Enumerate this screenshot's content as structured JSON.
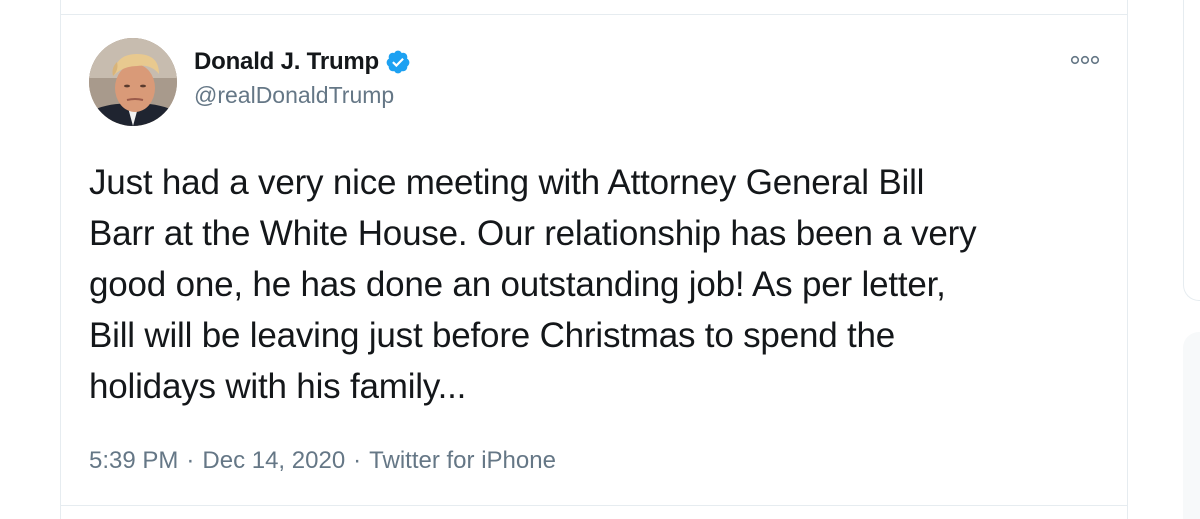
{
  "tweet": {
    "display_name": "Donald J. Trump",
    "handle": "@realDonaldTrump",
    "verified": true,
    "text_lines": [
      "Just had a very nice meeting with Attorney General Bill",
      "Barr at the White House. Our relationship has been a very",
      "good one, he has done an outstanding job! As per letter,",
      "Bill will be leaving just before Christmas to spend the",
      "holidays with his family..."
    ],
    "time": "5:39 PM",
    "separator": "·",
    "date": "Dec 14, 2020",
    "source": "Twitter for iPhone"
  },
  "icons": {
    "verified": "verified-badge-icon",
    "more": "more-options-icon"
  },
  "colors": {
    "accent": "#1da1f2",
    "text_primary": "#14171a",
    "text_secondary": "#657786",
    "border": "#e6ecf0"
  }
}
